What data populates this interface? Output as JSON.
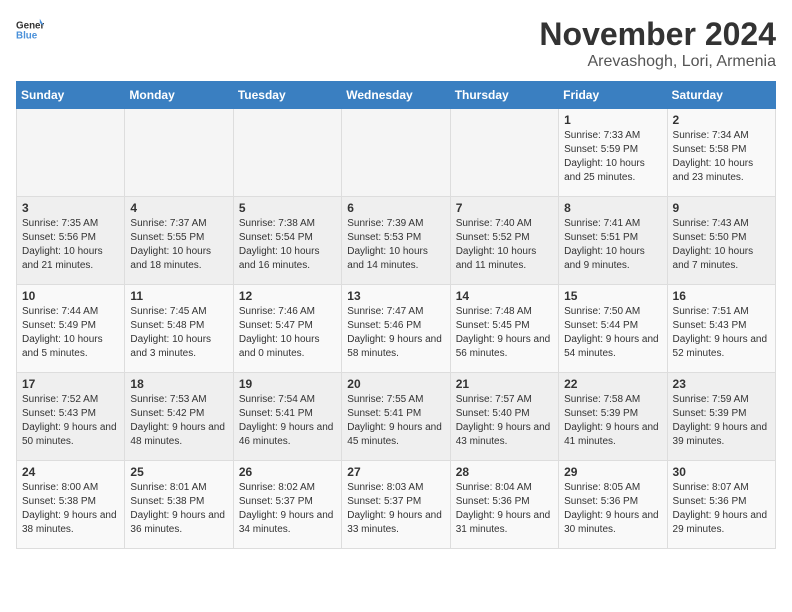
{
  "logo": {
    "general": "General",
    "blue": "Blue"
  },
  "header": {
    "month": "November 2024",
    "location": "Arevashogh, Lori, Armenia"
  },
  "days_of_week": [
    "Sunday",
    "Monday",
    "Tuesday",
    "Wednesday",
    "Thursday",
    "Friday",
    "Saturday"
  ],
  "weeks": [
    [
      {
        "day": "",
        "info": ""
      },
      {
        "day": "",
        "info": ""
      },
      {
        "day": "",
        "info": ""
      },
      {
        "day": "",
        "info": ""
      },
      {
        "day": "",
        "info": ""
      },
      {
        "day": "1",
        "info": "Sunrise: 7:33 AM\nSunset: 5:59 PM\nDaylight: 10 hours and 25 minutes."
      },
      {
        "day": "2",
        "info": "Sunrise: 7:34 AM\nSunset: 5:58 PM\nDaylight: 10 hours and 23 minutes."
      }
    ],
    [
      {
        "day": "3",
        "info": "Sunrise: 7:35 AM\nSunset: 5:56 PM\nDaylight: 10 hours and 21 minutes."
      },
      {
        "day": "4",
        "info": "Sunrise: 7:37 AM\nSunset: 5:55 PM\nDaylight: 10 hours and 18 minutes."
      },
      {
        "day": "5",
        "info": "Sunrise: 7:38 AM\nSunset: 5:54 PM\nDaylight: 10 hours and 16 minutes."
      },
      {
        "day": "6",
        "info": "Sunrise: 7:39 AM\nSunset: 5:53 PM\nDaylight: 10 hours and 14 minutes."
      },
      {
        "day": "7",
        "info": "Sunrise: 7:40 AM\nSunset: 5:52 PM\nDaylight: 10 hours and 11 minutes."
      },
      {
        "day": "8",
        "info": "Sunrise: 7:41 AM\nSunset: 5:51 PM\nDaylight: 10 hours and 9 minutes."
      },
      {
        "day": "9",
        "info": "Sunrise: 7:43 AM\nSunset: 5:50 PM\nDaylight: 10 hours and 7 minutes."
      }
    ],
    [
      {
        "day": "10",
        "info": "Sunrise: 7:44 AM\nSunset: 5:49 PM\nDaylight: 10 hours and 5 minutes."
      },
      {
        "day": "11",
        "info": "Sunrise: 7:45 AM\nSunset: 5:48 PM\nDaylight: 10 hours and 3 minutes."
      },
      {
        "day": "12",
        "info": "Sunrise: 7:46 AM\nSunset: 5:47 PM\nDaylight: 10 hours and 0 minutes."
      },
      {
        "day": "13",
        "info": "Sunrise: 7:47 AM\nSunset: 5:46 PM\nDaylight: 9 hours and 58 minutes."
      },
      {
        "day": "14",
        "info": "Sunrise: 7:48 AM\nSunset: 5:45 PM\nDaylight: 9 hours and 56 minutes."
      },
      {
        "day": "15",
        "info": "Sunrise: 7:50 AM\nSunset: 5:44 PM\nDaylight: 9 hours and 54 minutes."
      },
      {
        "day": "16",
        "info": "Sunrise: 7:51 AM\nSunset: 5:43 PM\nDaylight: 9 hours and 52 minutes."
      }
    ],
    [
      {
        "day": "17",
        "info": "Sunrise: 7:52 AM\nSunset: 5:43 PM\nDaylight: 9 hours and 50 minutes."
      },
      {
        "day": "18",
        "info": "Sunrise: 7:53 AM\nSunset: 5:42 PM\nDaylight: 9 hours and 48 minutes."
      },
      {
        "day": "19",
        "info": "Sunrise: 7:54 AM\nSunset: 5:41 PM\nDaylight: 9 hours and 46 minutes."
      },
      {
        "day": "20",
        "info": "Sunrise: 7:55 AM\nSunset: 5:41 PM\nDaylight: 9 hours and 45 minutes."
      },
      {
        "day": "21",
        "info": "Sunrise: 7:57 AM\nSunset: 5:40 PM\nDaylight: 9 hours and 43 minutes."
      },
      {
        "day": "22",
        "info": "Sunrise: 7:58 AM\nSunset: 5:39 PM\nDaylight: 9 hours and 41 minutes."
      },
      {
        "day": "23",
        "info": "Sunrise: 7:59 AM\nSunset: 5:39 PM\nDaylight: 9 hours and 39 minutes."
      }
    ],
    [
      {
        "day": "24",
        "info": "Sunrise: 8:00 AM\nSunset: 5:38 PM\nDaylight: 9 hours and 38 minutes."
      },
      {
        "day": "25",
        "info": "Sunrise: 8:01 AM\nSunset: 5:38 PM\nDaylight: 9 hours and 36 minutes."
      },
      {
        "day": "26",
        "info": "Sunrise: 8:02 AM\nSunset: 5:37 PM\nDaylight: 9 hours and 34 minutes."
      },
      {
        "day": "27",
        "info": "Sunrise: 8:03 AM\nSunset: 5:37 PM\nDaylight: 9 hours and 33 minutes."
      },
      {
        "day": "28",
        "info": "Sunrise: 8:04 AM\nSunset: 5:36 PM\nDaylight: 9 hours and 31 minutes."
      },
      {
        "day": "29",
        "info": "Sunrise: 8:05 AM\nSunset: 5:36 PM\nDaylight: 9 hours and 30 minutes."
      },
      {
        "day": "30",
        "info": "Sunrise: 8:07 AM\nSunset: 5:36 PM\nDaylight: 9 hours and 29 minutes."
      }
    ]
  ]
}
